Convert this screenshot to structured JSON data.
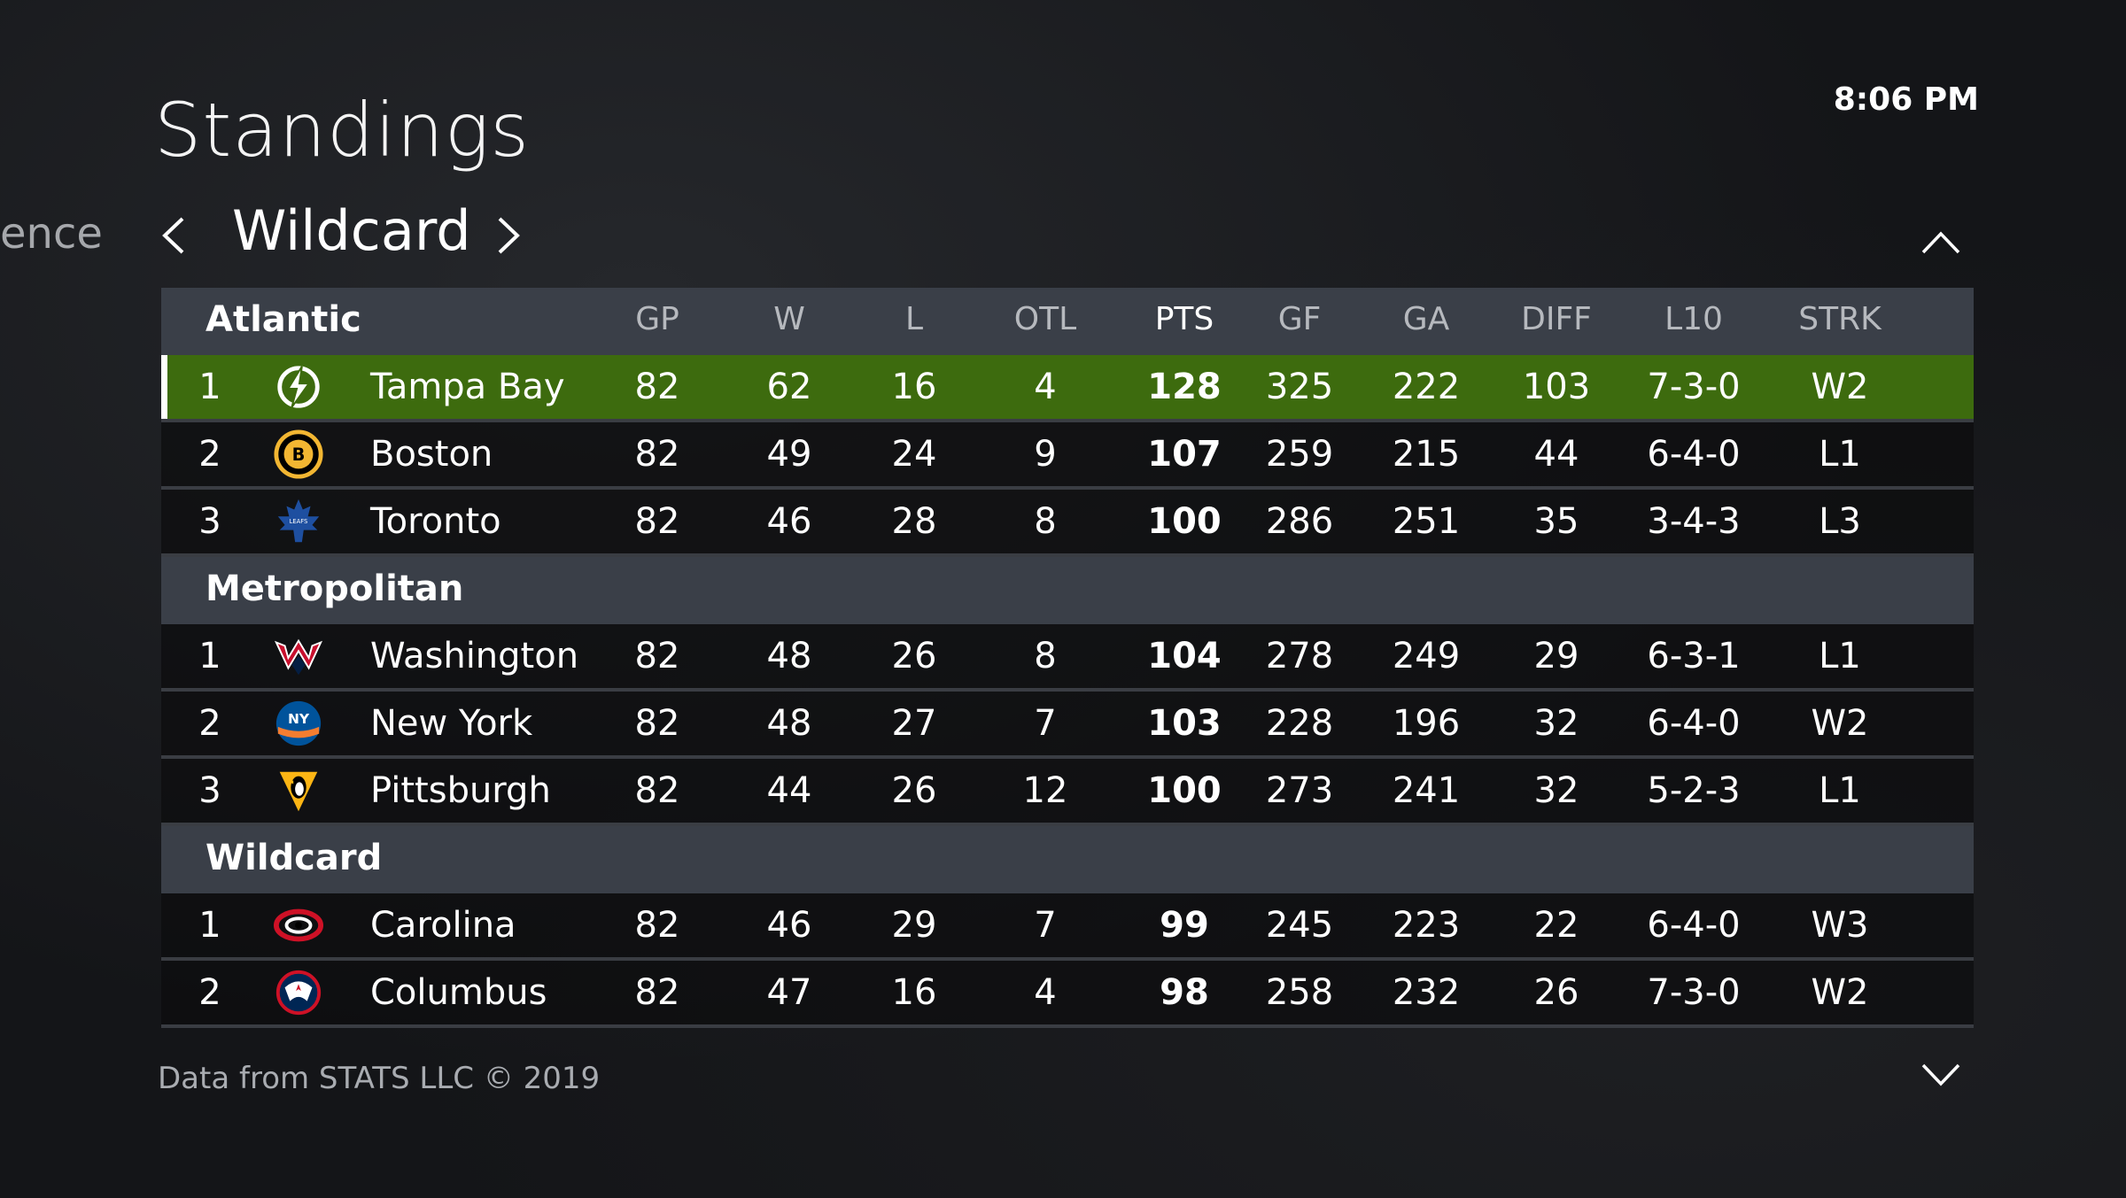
{
  "header": {
    "title": "Standings",
    "time": "8:06 PM"
  },
  "tabs": {
    "previous_label": "ence",
    "current_label": "Wildcard"
  },
  "table": {
    "columns": [
      "GP",
      "W",
      "L",
      "OTL",
      "PTS",
      "GF",
      "GA",
      "DIFF",
      "L10",
      "STRK"
    ],
    "sections": [
      {
        "name": "Atlantic",
        "teams": [
          {
            "rank": "1",
            "team": "Tampa Bay",
            "logo_icon": "lightning-logo-icon",
            "gp": "82",
            "w": "62",
            "l": "16",
            "otl": "4",
            "pts": "128",
            "gf": "325",
            "ga": "222",
            "diff": "103",
            "l10": "7-3-0",
            "strk": "W2"
          },
          {
            "rank": "2",
            "team": "Boston",
            "logo_icon": "bruins-logo-icon",
            "gp": "82",
            "w": "49",
            "l": "24",
            "otl": "9",
            "pts": "107",
            "gf": "259",
            "ga": "215",
            "diff": "44",
            "l10": "6-4-0",
            "strk": "L1"
          },
          {
            "rank": "3",
            "team": "Toronto",
            "logo_icon": "maple-leafs-logo-icon",
            "gp": "82",
            "w": "46",
            "l": "28",
            "otl": "8",
            "pts": "100",
            "gf": "286",
            "ga": "251",
            "diff": "35",
            "l10": "3-4-3",
            "strk": "L3"
          }
        ]
      },
      {
        "name": "Metropolitan",
        "teams": [
          {
            "rank": "1",
            "team": "Washington",
            "logo_icon": "capitals-logo-icon",
            "gp": "82",
            "w": "48",
            "l": "26",
            "otl": "8",
            "pts": "104",
            "gf": "278",
            "ga": "249",
            "diff": "29",
            "l10": "6-3-1",
            "strk": "L1"
          },
          {
            "rank": "2",
            "team": "New York",
            "logo_icon": "islanders-logo-icon",
            "gp": "82",
            "w": "48",
            "l": "27",
            "otl": "7",
            "pts": "103",
            "gf": "228",
            "ga": "196",
            "diff": "32",
            "l10": "6-4-0",
            "strk": "W2"
          },
          {
            "rank": "3",
            "team": "Pittsburgh",
            "logo_icon": "penguins-logo-icon",
            "gp": "82",
            "w": "44",
            "l": "26",
            "otl": "12",
            "pts": "100",
            "gf": "273",
            "ga": "241",
            "diff": "32",
            "l10": "5-2-3",
            "strk": "L1"
          }
        ]
      },
      {
        "name": "Wildcard",
        "teams": [
          {
            "rank": "1",
            "team": "Carolina",
            "logo_icon": "hurricanes-logo-icon",
            "gp": "82",
            "w": "46",
            "l": "29",
            "otl": "7",
            "pts": "99",
            "gf": "245",
            "ga": "223",
            "diff": "22",
            "l10": "6-4-0",
            "strk": "W3"
          },
          {
            "rank": "2",
            "team": "Columbus",
            "logo_icon": "blue-jackets-logo-icon",
            "gp": "82",
            "w": "47",
            "l": "16",
            "otl": "4",
            "pts": "98",
            "gf": "258",
            "ga": "232",
            "diff": "26",
            "l10": "7-3-0",
            "strk": "W2"
          }
        ]
      }
    ]
  },
  "footer": {
    "credit": "Data from STATS LLC © 2019"
  },
  "colors": {
    "selected_row": "#3d6b0e",
    "header_row": "#3a3f48",
    "background": "#141518"
  }
}
